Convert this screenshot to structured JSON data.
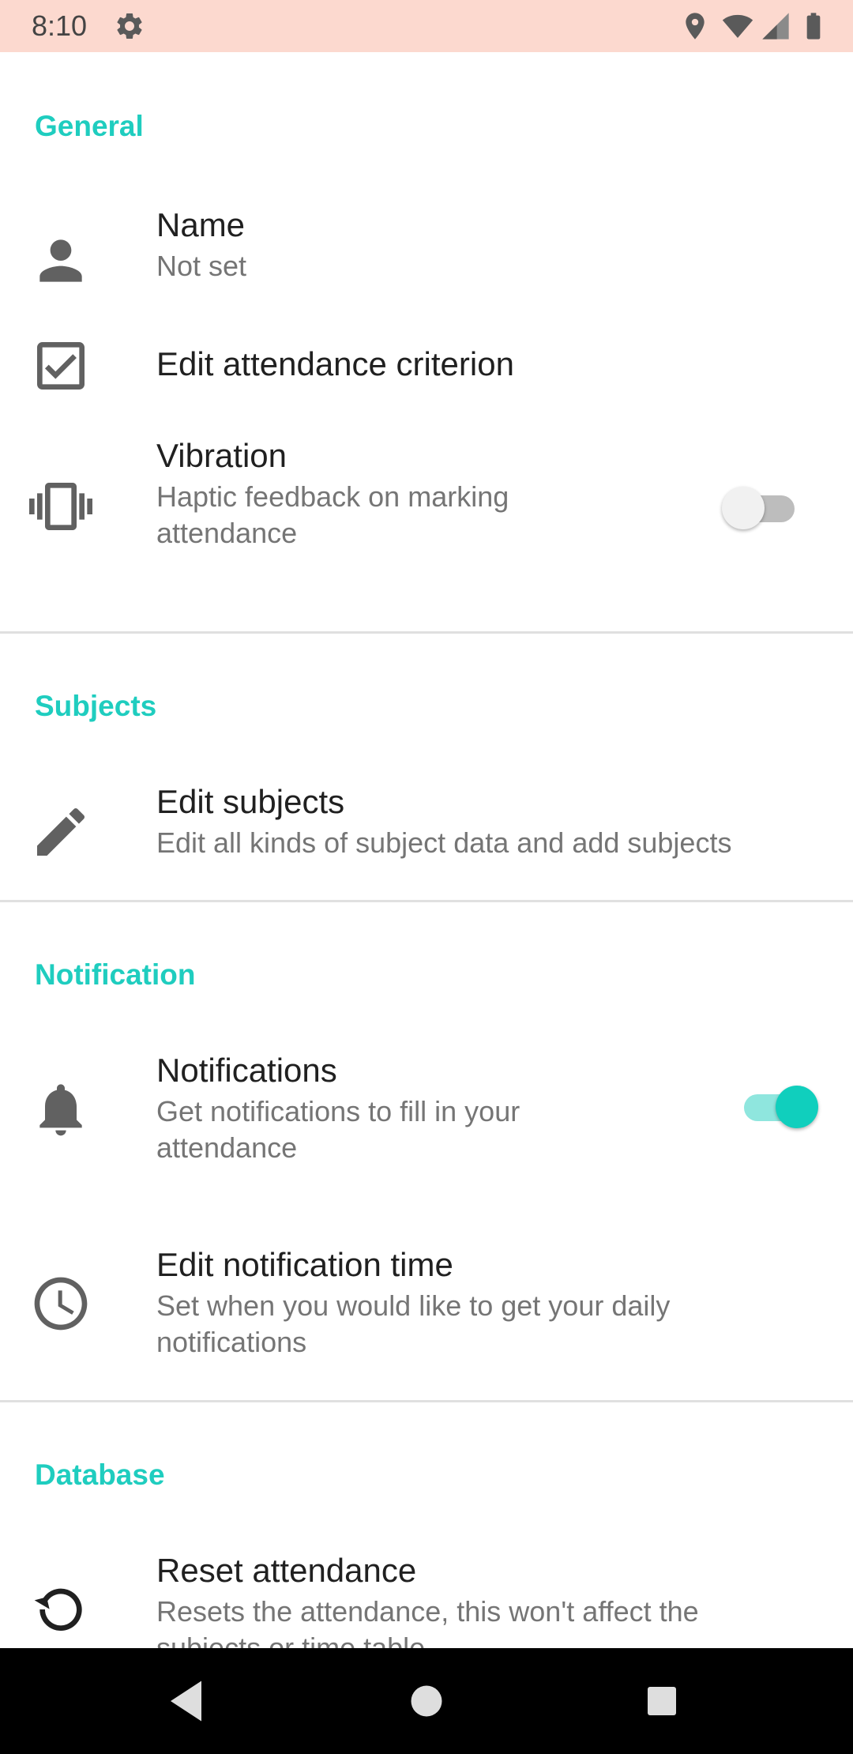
{
  "status_bar": {
    "time": "8:10",
    "icons": [
      "gear-icon",
      "location-icon",
      "wifi-icon",
      "cell-signal-icon",
      "battery-icon"
    ],
    "background": "#fcd9cf"
  },
  "colors": {
    "accent": "#1fcdbf",
    "title_text": "#202020",
    "summary_text": "#757575",
    "icon": "#616161"
  },
  "sections": {
    "general": {
      "header": "General",
      "name": {
        "title": "Name",
        "summary": "Not set",
        "icon": "person-icon"
      },
      "criterion": {
        "title": "Edit attendance criterion",
        "icon": "checkbox-icon"
      },
      "vibration": {
        "title": "Vibration",
        "summary": "Haptic feedback on marking attendance",
        "icon": "vibration-icon",
        "enabled": false
      }
    },
    "subjects": {
      "header": "Subjects",
      "edit_subjects": {
        "title": "Edit subjects",
        "summary": "Edit all kinds of subject data and add subjects",
        "icon": "pencil-icon"
      }
    },
    "notification": {
      "header": "Notification",
      "notifications": {
        "title": "Notifications",
        "summary": "Get notifications to fill in your attendance",
        "icon": "bell-icon",
        "enabled": true
      },
      "notification_time": {
        "title": "Edit notification time",
        "summary": "Set when you would like to get your daily notifications",
        "icon": "clock-icon"
      }
    },
    "database": {
      "header": "Database",
      "reset": {
        "title": "Reset attendance",
        "summary": "Resets the attendance, this won't affect the subjects or time table",
        "icon": "reset-icon"
      }
    }
  },
  "nav_bar": {
    "buttons": [
      "back-icon",
      "home-icon",
      "recents-icon"
    ]
  }
}
